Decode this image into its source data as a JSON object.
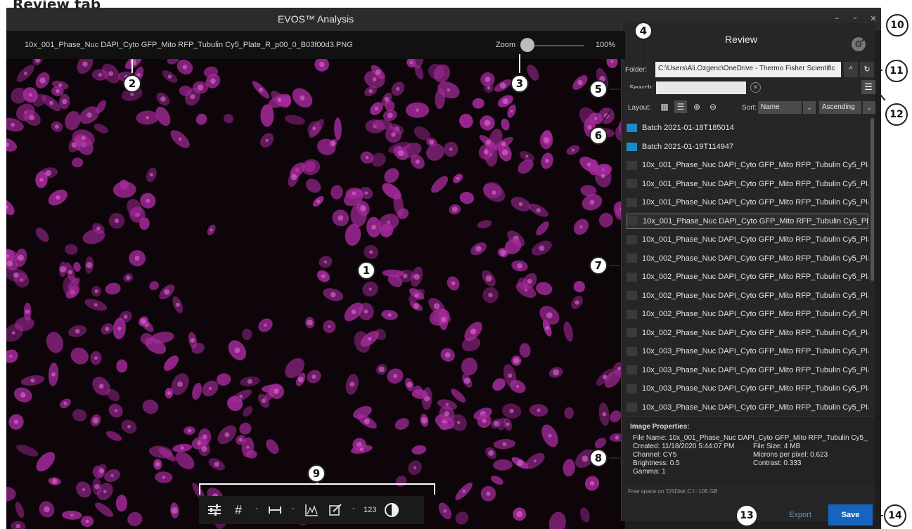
{
  "page_heading": "Review tab",
  "app": {
    "title": "EVOS™ Analysis",
    "window_controls": [
      "–",
      "▫",
      "✕"
    ]
  },
  "viewer": {
    "file_name": "10x_001_Phase_Nuc DAPI_Cyto GFP_Mito RFP_Tubulin Cy5_Plate_R_p00_0_B03f00d3.PNG",
    "zoom_label": "Zoom",
    "zoom_value": "100%",
    "zoom_level_percent": 100,
    "cell_color": "#a52a9b",
    "toolbar": {
      "items": [
        "adjust-sliders-icon",
        "grid-hash-icon",
        "measure-ruler-icon",
        "histogram-icon",
        "annotate-edit-icon",
        "number-label",
        "contrast-icon"
      ],
      "number_label": "123"
    }
  },
  "panel": {
    "title": "Review",
    "folder_label": "Folder:",
    "folder_value": "C:\\Users\\Ali.Ozgenc\\OneDrive - Thermo Fisher Scientific",
    "search_label": "Search:",
    "search_value": "",
    "layout_label": "Layout:",
    "sort_label": "Sort:",
    "sort_by": "Name",
    "sort_order": "Ascending",
    "files": [
      {
        "type": "folder",
        "name": "Batch 2021-01-18T185014"
      },
      {
        "type": "folder",
        "name": "Batch 2021-01-19T114947"
      },
      {
        "type": "image",
        "name": "10x_001_Phase_Nuc DAPI_Cyto GFP_Mito RFP_Tubulin Cy5_Pla..."
      },
      {
        "type": "image",
        "name": "10x_001_Phase_Nuc DAPI_Cyto GFP_Mito RFP_Tubulin Cy5_Pla..."
      },
      {
        "type": "image",
        "name": "10x_001_Phase_Nuc DAPI_Cyto GFP_Mito RFP_Tubulin Cy5_Pla..."
      },
      {
        "type": "image",
        "name": "10x_001_Phase_Nuc DAPI_Cyto GFP_Mito RFP_Tubulin Cy5_Pla...",
        "selected": true
      },
      {
        "type": "image",
        "name": "10x_001_Phase_Nuc DAPI_Cyto GFP_Mito RFP_Tubulin Cy5_Pla..."
      },
      {
        "type": "image",
        "name": "10x_002_Phase_Nuc DAPI_Cyto GFP_Mito RFP_Tubulin Cy5_Pla..."
      },
      {
        "type": "image",
        "name": "10x_002_Phase_Nuc DAPI_Cyto GFP_Mito RFP_Tubulin Cy5_Pla..."
      },
      {
        "type": "image",
        "name": "10x_002_Phase_Nuc DAPI_Cyto GFP_Mito RFP_Tubulin Cy5_Pla..."
      },
      {
        "type": "image",
        "name": "10x_002_Phase_Nuc DAPI_Cyto GFP_Mito RFP_Tubulin Cy5_Pla..."
      },
      {
        "type": "image",
        "name": "10x_002_Phase_Nuc DAPI_Cyto GFP_Mito RFP_Tubulin Cy5_Pla..."
      },
      {
        "type": "image",
        "name": "10x_003_Phase_Nuc DAPI_Cyto GFP_Mito RFP_Tubulin Cy5_Pla..."
      },
      {
        "type": "image",
        "name": "10x_003_Phase_Nuc DAPI_Cyto GFP_Mito RFP_Tubulin Cy5_Pla..."
      },
      {
        "type": "image",
        "name": "10x_003_Phase_Nuc DAPI_Cyto GFP_Mito RFP_Tubulin Cy5_Pla..."
      },
      {
        "type": "image",
        "name": "10x_003_Phase_Nuc DAPI_Cyto GFP_Mito RFP_Tubulin Cy5_Pla..."
      }
    ],
    "properties": {
      "heading": "Image Properties:",
      "file_name": "File Name: 10x_001_Phase_Nuc DAPI_Cyto GFP_Mito RFP_Tubulin Cy5_",
      "created": "Created: 11/18/2020 5:44:07 PM",
      "file_size": "File Size: 4 MB",
      "channel": "Channel: CY5",
      "microns": "Microns per pixel: 0.623",
      "brightness": "Brightness: 0.5",
      "contrast": "Contrast: 0.333",
      "gamma": "Gamma: 1"
    },
    "free_space": "Free space on 'OSDisk C:\\': 105 GB",
    "export_label": "Export",
    "save_label": "Save"
  },
  "callouts": [
    "1",
    "2",
    "3",
    "4",
    "5",
    "6",
    "7",
    "8",
    "9",
    "10",
    "11",
    "12",
    "13",
    "14"
  ],
  "colors": {
    "accent": "#1565c0",
    "folder": "#1c8ac9",
    "background": "#1e1e1e"
  }
}
